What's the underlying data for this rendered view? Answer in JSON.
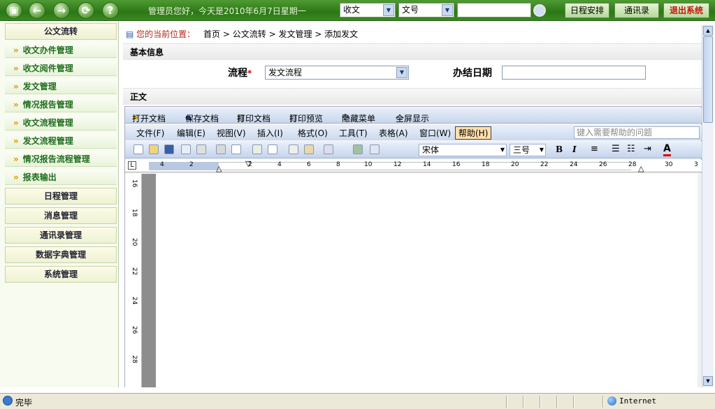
{
  "topbar": {
    "greeting": "管理员您好，今天是2010年6月7日星期一",
    "doc_type_select": "收文",
    "field_select": "文号",
    "search_value": "",
    "schedule_btn": "日程安排",
    "contacts_btn": "通讯录",
    "exit_btn": "退出系统"
  },
  "sidebar": {
    "section_title": "公文流转",
    "items": [
      {
        "label": "收文办件管理"
      },
      {
        "label": "收文阅件管理"
      },
      {
        "label": "发文管理"
      },
      {
        "label": "情况报告管理"
      },
      {
        "label": "收文流程管理"
      },
      {
        "label": "发文流程管理"
      },
      {
        "label": "情况报告流程管理"
      },
      {
        "label": "报表输出"
      }
    ],
    "groups": [
      "日程管理",
      "消息管理",
      "通讯录管理",
      "数据字典管理",
      "系统管理"
    ]
  },
  "breadcrumb": {
    "prefix": "您的当前位置：",
    "path": [
      "首页",
      "公文流转",
      "发文管理",
      "添加发文"
    ]
  },
  "basic_info": {
    "title": "基本信息",
    "flow_label": "流程",
    "required_mark": "*",
    "flow_value": "发文流程",
    "due_label": "办结日期",
    "due_value": ""
  },
  "body_section": {
    "title": "正文"
  },
  "word_toolbar": {
    "buttons": [
      "打开文档",
      "保存文档",
      "打印文档",
      "打印预览",
      "隐藏菜单",
      "全屏显示"
    ]
  },
  "word_menu": {
    "items": [
      "文件(F)",
      "编辑(E)",
      "视图(V)",
      "插入(I)",
      "格式(O)",
      "工具(T)",
      "表格(A)",
      "窗口(W)",
      "帮助(H)"
    ],
    "help_placeholder": "键入需要帮助的问题"
  },
  "word_format": {
    "font": "宋体",
    "size": "三号",
    "bold": "B",
    "italic": "I",
    "font_color": "A"
  },
  "ruler": {
    "h_ticks": [
      "4",
      "2",
      "2",
      "4",
      "6",
      "8",
      "10",
      "12",
      "14",
      "16",
      "18",
      "20",
      "22",
      "24",
      "26",
      "28",
      "30",
      "3"
    ],
    "v_ticks": [
      "16",
      "18",
      "20",
      "22",
      "24",
      "26",
      "28"
    ]
  },
  "status": {
    "left": "完毕",
    "zone": "Internet"
  }
}
